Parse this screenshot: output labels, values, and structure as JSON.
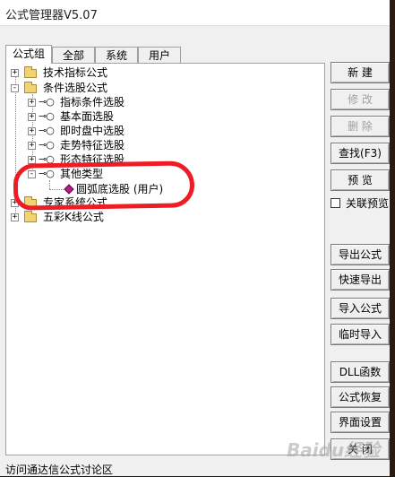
{
  "window": {
    "title": "公式管理器V5.07"
  },
  "tabs": [
    {
      "label": "公式组",
      "active": true
    },
    {
      "label": "全部",
      "active": false
    },
    {
      "label": "系统",
      "active": false
    },
    {
      "label": "用户",
      "active": false
    }
  ],
  "tree": {
    "groups": [
      {
        "label": "技术指标公式",
        "expander": "+"
      },
      {
        "label": "条件选股公式",
        "expander": "-"
      },
      {
        "label": "专家系统公式",
        "expander": "+"
      },
      {
        "label": "五彩K线公式",
        "expander": "+"
      }
    ],
    "subgroups": [
      {
        "label": "指标条件选股",
        "expander": "+"
      },
      {
        "label": "基本面选股",
        "expander": "+"
      },
      {
        "label": "即时盘中选股",
        "expander": "+"
      },
      {
        "label": "走势特征选股",
        "expander": "+"
      },
      {
        "label": "形态特征选股",
        "expander": "+"
      },
      {
        "label": "其他类型",
        "expander": "-"
      }
    ],
    "formula": {
      "label": "圆弧底选股 (用户)"
    },
    "key_glyph": "⊸○"
  },
  "buttons": {
    "new": "新 建",
    "modify": "修 改",
    "delete": "删 除",
    "find": "查找(F3)",
    "preview": "预 览",
    "export": "导出公式",
    "quick_export": "快速导出",
    "import": "导入公式",
    "temp_import": "临时导入",
    "dll": "DLL函数",
    "restore": "公式恢复",
    "ui_settings": "界面设置",
    "close": "关 闭"
  },
  "checkbox": {
    "label": "关联预览",
    "checked": false
  },
  "statusbar": {
    "text": "访问通达信公式讨论区"
  },
  "watermark": {
    "text": "Baidu经验"
  },
  "colors": {
    "highlight": "#ee1c25",
    "folder": "#f2d374",
    "formula_icon": "#b5198b"
  }
}
